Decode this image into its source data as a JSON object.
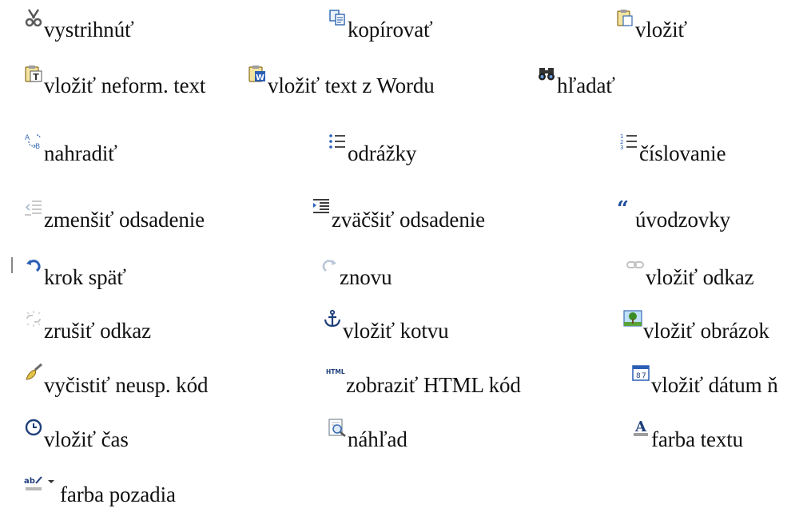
{
  "items": [
    {
      "label": "vystrihnúť",
      "icon": "cut-icon"
    },
    {
      "label": "kopírovať",
      "icon": "copy-icon"
    },
    {
      "label": "vložiť",
      "icon": "paste-icon"
    },
    {
      "label": "vložiť neform. text",
      "icon": "paste-plain-text-icon"
    },
    {
      "label": "vložiť text z Wordu",
      "icon": "paste-from-word-icon"
    },
    {
      "label": "hľadať",
      "icon": "find-binoculars-icon"
    },
    {
      "label": "nahradiť",
      "icon": "replace-icon"
    },
    {
      "label": "odrážky",
      "icon": "bulleted-list-icon"
    },
    {
      "label": "číslovanie",
      "icon": "numbered-list-icon"
    },
    {
      "label": "zmenšiť odsadenie",
      "icon": "outdent-icon"
    },
    {
      "label": "zväčšiť odsadenie",
      "icon": "indent-icon"
    },
    {
      "label": "úvodzovky",
      "icon": "blockquote-icon"
    },
    {
      "label": "krok späť",
      "icon": "undo-icon"
    },
    {
      "label": "znovu",
      "icon": "redo-icon"
    },
    {
      "label": "vložiť odkaz",
      "icon": "link-icon"
    },
    {
      "label": "zrušiť odkaz",
      "icon": "unlink-icon"
    },
    {
      "label": "vložiť kotvu",
      "icon": "anchor-icon"
    },
    {
      "label": "vložiť obrázok",
      "icon": "image-icon"
    },
    {
      "label": "vyčistiť neusp. kód",
      "icon": "cleanup-brush-icon"
    },
    {
      "label": "zobraziť HTML kód",
      "icon": "html-source-icon"
    },
    {
      "label": "vložiť dátum ň",
      "icon": "insert-date-icon"
    },
    {
      "label": "vložiť čas",
      "icon": "insert-time-icon"
    },
    {
      "label": "náhľad",
      "icon": "preview-icon"
    },
    {
      "label": "farba textu",
      "icon": "text-color-icon"
    },
    {
      "label": "farba pozadia",
      "icon": "background-color-icon"
    }
  ]
}
